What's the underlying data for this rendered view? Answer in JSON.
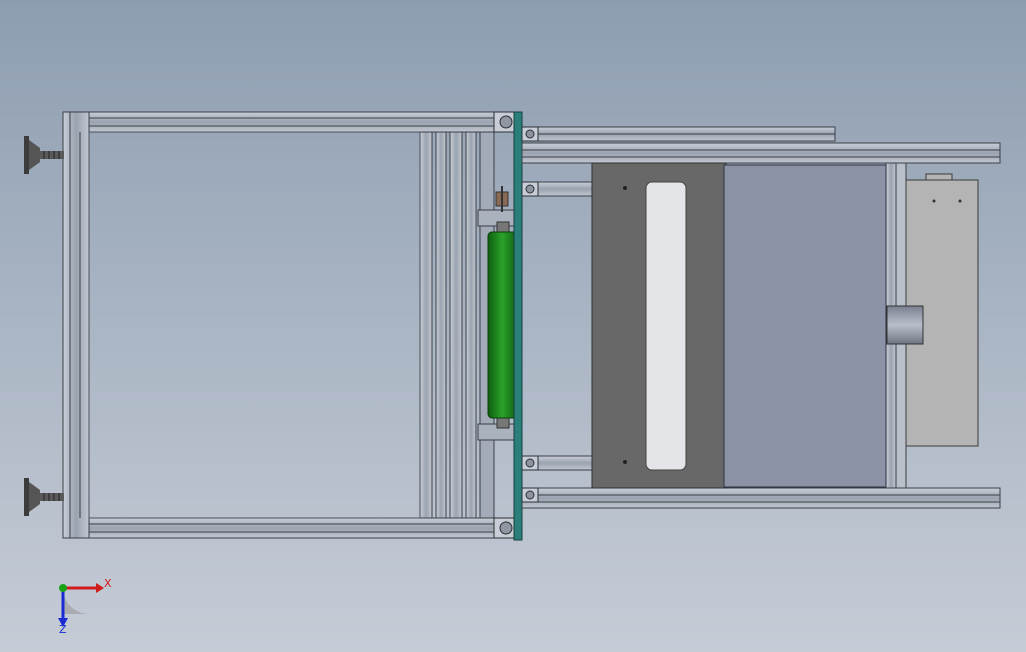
{
  "viewport": {
    "background_top": "#8d9db0",
    "background_bottom": "#c6ccd6"
  },
  "model": {
    "frame_color": "#aeb6c2",
    "frame_edge_color": "#3a3f47",
    "roller_color": "#1f8a1f",
    "base_plate_color": "#686868",
    "upper_plate_color": "#8d93a6",
    "side_panel_color": "#b4b4b4",
    "edge_strip_color": "#2a7f7a"
  },
  "triad": {
    "x_label": "X",
    "z_label": "Z",
    "x_color": "#d11a1a",
    "y_color": "#19a319",
    "z_color": "#1a2bd1"
  }
}
